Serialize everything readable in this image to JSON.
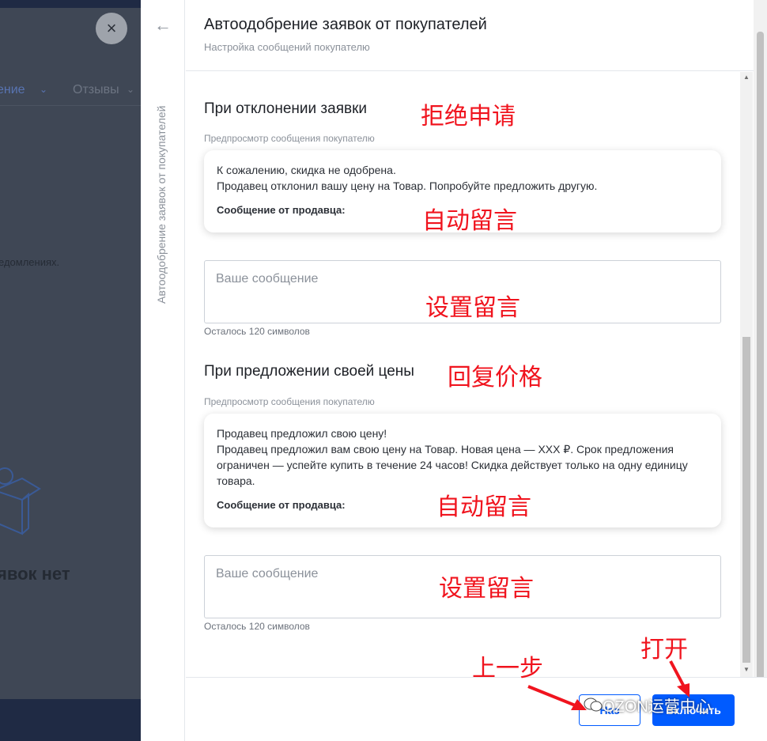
{
  "background": {
    "close_glyph": "×",
    "tab_active": "ение",
    "tab_reviews": "Отзывы",
    "chevron": "⌄",
    "notice_fragment": "едомлениях.",
    "empty_text": "явок нет"
  },
  "drawer": {
    "rail_title": "Автоодобрение заявок от покупателей",
    "title": "Автоодобрение заявок от покупателей",
    "subtitle": "Настройка сообщений покупателю",
    "reject_section": {
      "title": "При отклонении заявки",
      "preview_label": "Предпросмотр сообщения покупателю",
      "preview_line1": "К сожалению, скидка не одобрена.",
      "preview_line2": "Продавец отклонил вашу цену на Товар. Попробуйте предложить другую.",
      "seller_label": "Сообщение от продавца:",
      "input_placeholder": "Ваше сообщение",
      "char_count": "Осталось 120 символов"
    },
    "counter_section": {
      "title": "При предложении своей цены",
      "preview_label": "Предпросмотр сообщения покупателю",
      "preview_line1": "Продавец предложил свою цену!",
      "preview_line2": "Продавец предложил вам свою цену на Товар. Новая цена — XXX ₽. Срок предложения ограничен — успейте купить в течение 24 часов! Скидка действует только на одну единицу товара.",
      "seller_label": "Сообщение от продавца:",
      "input_placeholder": "Ваше сообщение",
      "char_count": "Осталось 120 символов"
    },
    "footer": {
      "back_label": "Наз",
      "enable_label": "Включить"
    }
  },
  "annotations": {
    "reject_request": "拒绝申请",
    "auto_message_1": "自动留言",
    "set_message_1": "设置留言",
    "reply_price": "回复价格",
    "auto_message_2": "自动留言",
    "set_message_2": "设置留言",
    "previous_step": "上一步",
    "open": "打开"
  },
  "watermark": "OZON运营中心",
  "colors": {
    "primary": "#005bff",
    "annotation": "#f0141e",
    "overlay": "#3f4755"
  }
}
